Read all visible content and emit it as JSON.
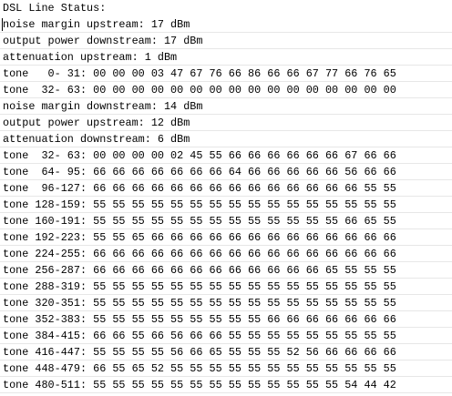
{
  "lines": [
    "DSL Line Status:",
    "noise margin upstream: 17 dBm",
    "output power downstream: 17 dBm",
    "attenuation upstream: 1 dBm",
    "tone   0- 31: 00 00 00 03 47 67 76 66 86 66 66 67 77 66 76 65",
    "tone  32- 63: 00 00 00 00 00 00 00 00 00 00 00 00 00 00 00 00",
    "noise margin downstream: 14 dBm",
    "output power upstream: 12 dBm",
    "attenuation downstream: 6 dBm",
    "tone  32- 63: 00 00 00 00 02 45 55 66 66 66 66 66 66 67 66 66",
    "tone  64- 95: 66 66 66 66 66 66 66 64 66 66 66 66 66 56 66 66",
    "tone  96-127: 66 66 66 66 66 66 66 66 66 66 66 66 66 66 55 55",
    "tone 128-159: 55 55 55 55 55 55 55 55 55 55 55 55 55 55 55 55",
    "tone 160-191: 55 55 55 55 55 55 55 55 55 55 55 55 55 66 65 55",
    "tone 192-223: 55 55 65 66 66 66 66 66 66 66 66 66 66 66 66 66",
    "tone 224-255: 66 66 66 66 66 66 66 66 66 66 66 66 66 66 66 66",
    "tone 256-287: 66 66 66 66 66 66 66 66 66 66 66 66 65 55 55 55",
    "tone 288-319: 55 55 55 55 55 55 55 55 55 55 55 55 55 55 55 55",
    "tone 320-351: 55 55 55 55 55 55 55 55 55 55 55 55 55 55 55 55",
    "tone 352-383: 55 55 55 55 55 55 55 55 55 66 66 66 66 66 66 66",
    "tone 384-415: 66 66 55 66 56 66 66 55 55 55 55 55 55 55 55 55",
    "tone 416-447: 55 55 55 55 56 66 65 55 55 55 52 56 66 66 66 66",
    "tone 448-479: 66 55 65 52 55 55 55 55 55 55 55 55 55 55 55 55",
    "tone 480-511: 55 55 55 55 55 55 55 55 55 55 55 55 55 54 44 42"
  ]
}
